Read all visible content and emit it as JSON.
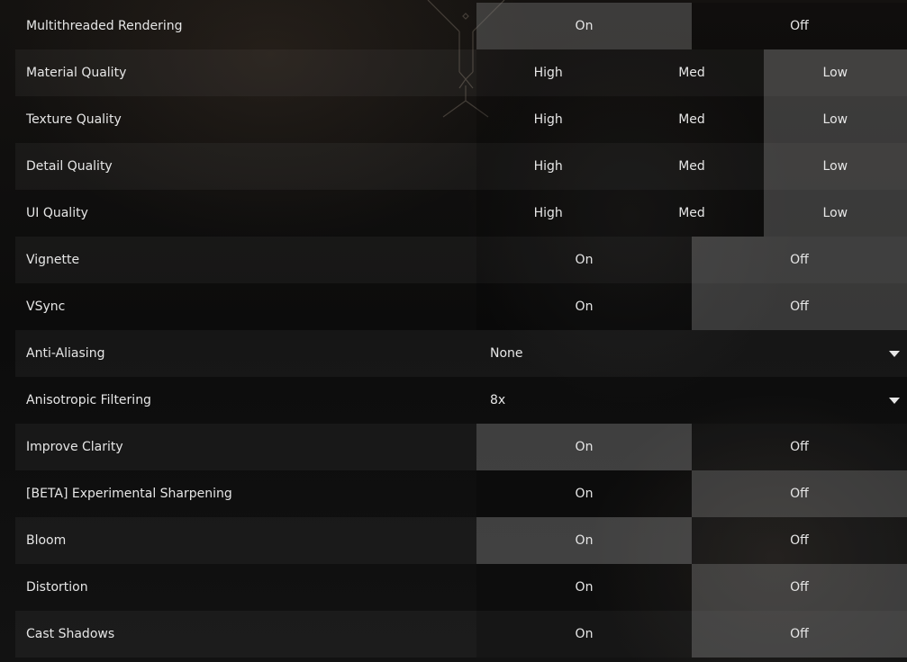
{
  "settings": [
    {
      "label": "Multithreaded Rendering",
      "type": "toggle",
      "options": [
        "On",
        "Off"
      ],
      "selected": 0
    },
    {
      "label": "Material Quality",
      "type": "toggle",
      "options": [
        "High",
        "Med",
        "Low"
      ],
      "selected": 2
    },
    {
      "label": "Texture Quality",
      "type": "toggle",
      "options": [
        "High",
        "Med",
        "Low"
      ],
      "selected": 2
    },
    {
      "label": "Detail Quality",
      "type": "toggle",
      "options": [
        "High",
        "Med",
        "Low"
      ],
      "selected": 2
    },
    {
      "label": "UI Quality",
      "type": "toggle",
      "options": [
        "High",
        "Med",
        "Low"
      ],
      "selected": 2
    },
    {
      "label": "Vignette",
      "type": "toggle",
      "options": [
        "On",
        "Off"
      ],
      "selected": 1
    },
    {
      "label": "VSync",
      "type": "toggle",
      "options": [
        "On",
        "Off"
      ],
      "selected": 1
    },
    {
      "label": "Anti-Aliasing",
      "type": "dropdown",
      "value": "None"
    },
    {
      "label": "Anisotropic Filtering",
      "type": "dropdown",
      "value": "8x"
    },
    {
      "label": "Improve Clarity",
      "type": "toggle",
      "options": [
        "On",
        "Off"
      ],
      "selected": 0
    },
    {
      "label": "[BETA] Experimental Sharpening",
      "type": "toggle",
      "options": [
        "On",
        "Off"
      ],
      "selected": 1
    },
    {
      "label": "Bloom",
      "type": "toggle",
      "options": [
        "On",
        "Off"
      ],
      "selected": 0
    },
    {
      "label": "Distortion",
      "type": "toggle",
      "options": [
        "On",
        "Off"
      ],
      "selected": 1
    },
    {
      "label": "Cast Shadows",
      "type": "toggle",
      "options": [
        "On",
        "Off"
      ],
      "selected": 1
    }
  ],
  "colors": {
    "selected": "#5a5a5a",
    "text": "#e6e6e6",
    "background": "#0b0b0b"
  },
  "icons": {
    "dropdown": "triangle-down-icon",
    "emblem": "game-logo-emblem"
  }
}
